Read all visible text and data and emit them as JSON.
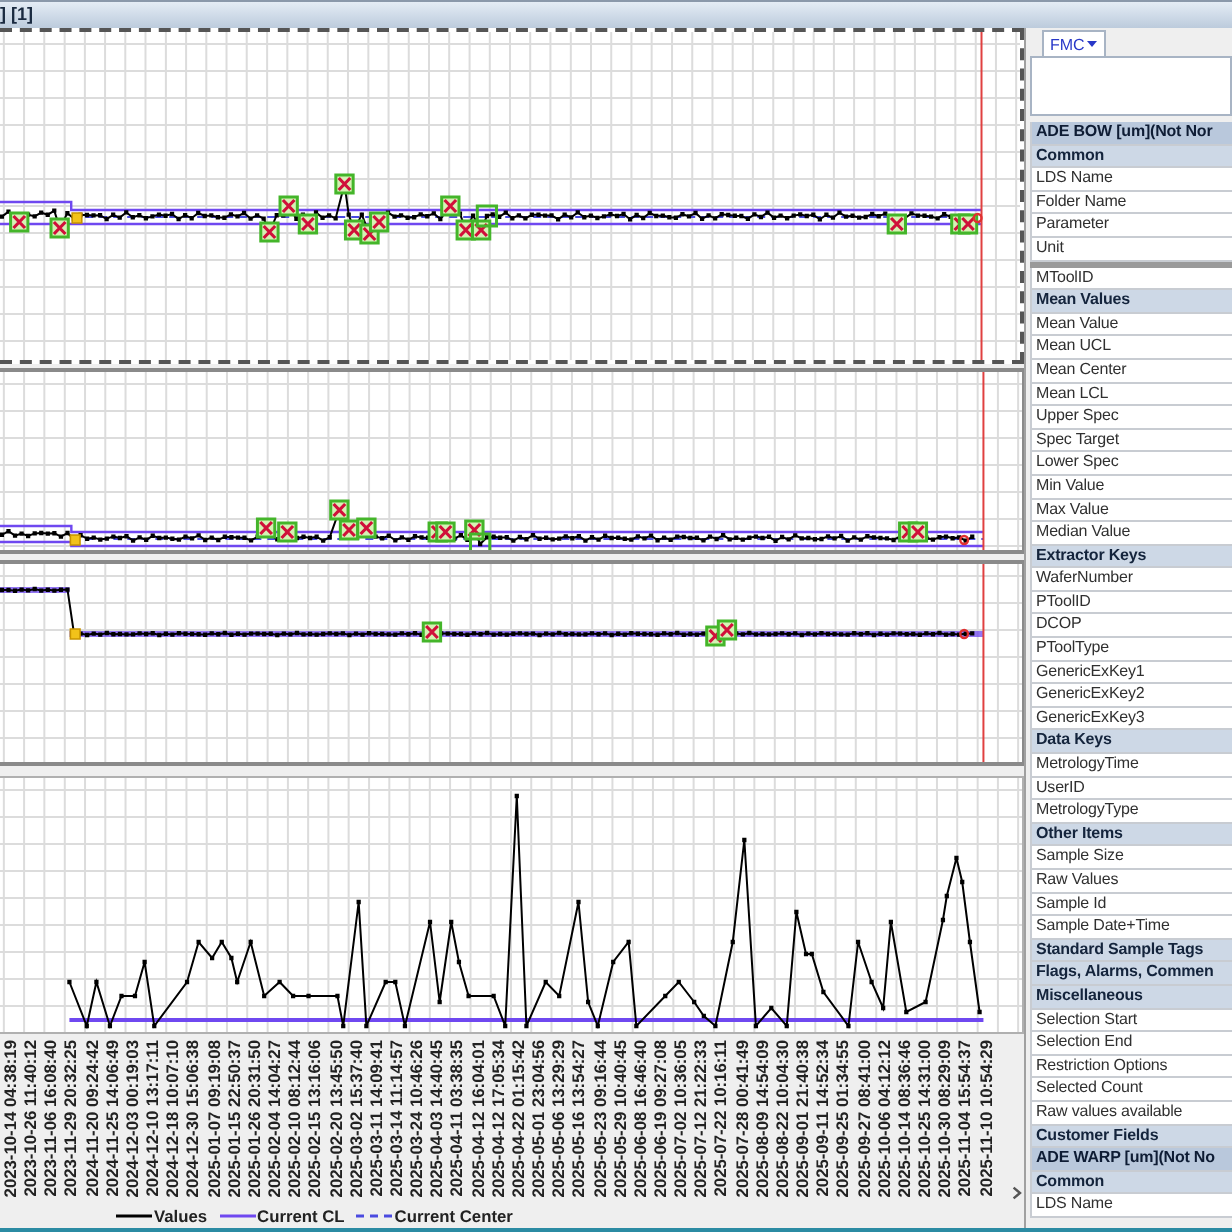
{
  "title_bar": {
    "title": "] [1]"
  },
  "charts": [
    {
      "selected": true
    },
    {
      "selected": false
    },
    {
      "selected": false
    },
    {
      "selected": false
    }
  ],
  "x_axis": {
    "labels": [
      "2023-10-14 04:38:19",
      "2023-10-26 11:40:12",
      "2023-11-06 16:08:40",
      "2023-11-29 20:32:25",
      "2024-11-20 09:24:42",
      "2024-11-25 14:06:49",
      "2024-12-03 00:19:03",
      "2024-12-10 13:17:11",
      "2024-12-18 10:07:10",
      "2024-12-30 15:06:38",
      "2025-01-07 09:19:08",
      "2025-01-15 22:50:37",
      "2025-01-26 20:31:50",
      "2025-02-04 14:04:27",
      "2025-02-10 08:12:44",
      "2025-02-15 13:16:06",
      "2025-02-20 13:45:50",
      "2025-03-02 15:37:40",
      "2025-03-11 14:09:41",
      "2025-03-14 11:14:57",
      "2025-03-24 10:46:26",
      "2025-04-03 14:40:45",
      "2025-04-11 03:38:35",
      "2025-04-12 16:04:01",
      "2025-04-12 17:05:34",
      "2025-04-22 01:15:42",
      "2025-05-01 23:04:56",
      "2025-05-06 13:29:29",
      "2025-05-16 13:54:27",
      "2025-05-23 09:16:44",
      "2025-05-29 10:40:45",
      "2025-06-08 16:46:40",
      "2025-06-19 09:27:08",
      "2025-07-02 10:36:05",
      "2025-07-12 21:22:33",
      "2025-07-22 10:16:11",
      "2025-07-28 00:41:49",
      "2025-08-09 14:54:09",
      "2025-08-22 10:04:30",
      "2025-09-01 21:40:38",
      "2025-09-11 14:52:34",
      "2025-09-25 01:34:55",
      "2025-09-27 08:41:00",
      "2025-10-06 04:12:12",
      "2025-10-14 08:36:46",
      "2025-10-25 14:31:00",
      "2025-10-30 08:29:09",
      "2025-11-04 15:54:37",
      "2025-11-10 10:54:29"
    ]
  },
  "legend": [
    {
      "label": "Values",
      "kind": "solid",
      "color": "#000000"
    },
    {
      "label": "Current CL",
      "kind": "solid",
      "color": "#6f48f0"
    },
    {
      "label": "Current Center",
      "kind": "dashed",
      "color": "#4a4ae0"
    }
  ],
  "side_panel": {
    "tab": {
      "label": "FMC"
    },
    "pinned_rows": [
      {
        "label": "ADE BOW [um](Not Nor",
        "kind": "group"
      },
      {
        "label": "Common",
        "kind": "section"
      },
      {
        "label": "LDS Name",
        "kind": "field"
      },
      {
        "label": "Folder Name",
        "kind": "field"
      },
      {
        "label": "Parameter",
        "kind": "field"
      },
      {
        "label": "Unit",
        "kind": "field"
      }
    ],
    "rows": [
      {
        "label": "MToolID",
        "kind": "field"
      },
      {
        "label": "Mean Values",
        "kind": "section"
      },
      {
        "label": "Mean Value",
        "kind": "field"
      },
      {
        "label": "Mean UCL",
        "kind": "field"
      },
      {
        "label": "Mean Center",
        "kind": "field"
      },
      {
        "label": "Mean LCL",
        "kind": "field"
      },
      {
        "label": "Upper Spec",
        "kind": "field"
      },
      {
        "label": "Spec Target",
        "kind": "field"
      },
      {
        "label": "Lower Spec",
        "kind": "field"
      },
      {
        "label": "Min Value",
        "kind": "field"
      },
      {
        "label": "Max Value",
        "kind": "field"
      },
      {
        "label": "Median Value",
        "kind": "field"
      },
      {
        "label": "Extractor Keys",
        "kind": "section"
      },
      {
        "label": "WaferNumber",
        "kind": "field"
      },
      {
        "label": "PToolID",
        "kind": "field"
      },
      {
        "label": "DCOP",
        "kind": "field"
      },
      {
        "label": "PToolType",
        "kind": "field"
      },
      {
        "label": "GenericExKey1",
        "kind": "field"
      },
      {
        "label": "GenericExKey2",
        "kind": "field"
      },
      {
        "label": "GenericExKey3",
        "kind": "field"
      },
      {
        "label": "Data Keys",
        "kind": "section"
      },
      {
        "label": "MetrologyTime",
        "kind": "field"
      },
      {
        "label": "UserID",
        "kind": "field"
      },
      {
        "label": "MetrologyType",
        "kind": "field"
      },
      {
        "label": "Other Items",
        "kind": "section"
      },
      {
        "label": "Sample Size",
        "kind": "field"
      },
      {
        "label": "Raw Values",
        "kind": "field"
      },
      {
        "label": "Sample Id",
        "kind": "field"
      },
      {
        "label": "Sample Date+Time",
        "kind": "field"
      },
      {
        "label": "Standard Sample Tags",
        "kind": "section"
      },
      {
        "label": "Flags, Alarms, Commen",
        "kind": "section"
      },
      {
        "label": "Miscellaneous",
        "kind": "section"
      },
      {
        "label": "Selection Start",
        "kind": "field"
      },
      {
        "label": "Selection End",
        "kind": "field"
      },
      {
        "label": "Restriction Options",
        "kind": "field"
      },
      {
        "label": "Selected Count",
        "kind": "field"
      },
      {
        "label": "Raw values available",
        "kind": "field"
      },
      {
        "label": "Customer Fields",
        "kind": "section"
      },
      {
        "label": "ADE WARP [um](Not No",
        "kind": "group"
      },
      {
        "label": "Common",
        "kind": "section"
      },
      {
        "label": "LDS Name",
        "kind": "field"
      }
    ]
  }
}
